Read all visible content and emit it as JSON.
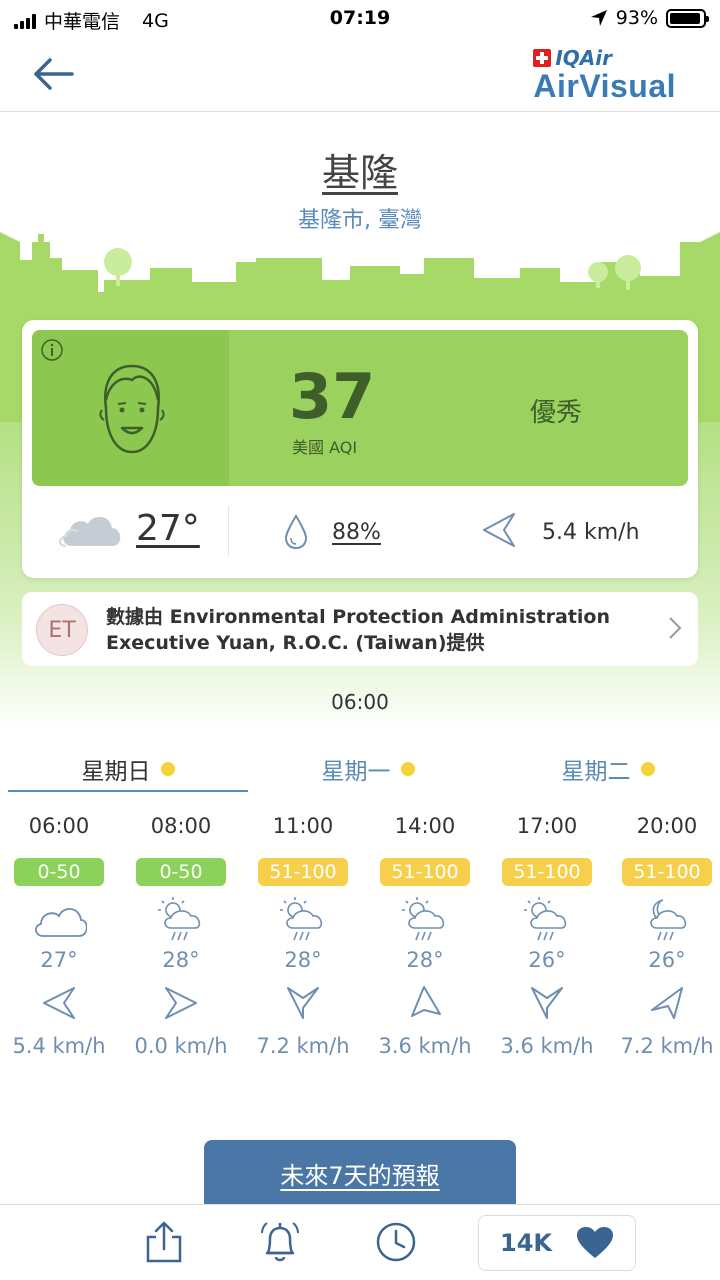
{
  "status_bar": {
    "carrier": "中華電信",
    "network": "4G",
    "time": "07:19",
    "battery": "93%"
  },
  "header": {
    "brand_top": "IQAir",
    "brand_bottom": "AirVisual"
  },
  "location": {
    "city": "基隆",
    "region": "基隆市, 臺灣"
  },
  "aqi": {
    "value": "37",
    "unit": "美國 AQI",
    "level": "優秀",
    "color": "#9ad15f"
  },
  "current_weather": {
    "temperature": "27°",
    "humidity": "88%",
    "wind": "5.4 km/h"
  },
  "source": {
    "badge": "ET",
    "text": "數據由 Environmental Protection Administration Executive Yuan, R.O.C. (Taiwan)提供"
  },
  "updated_time": "06:00",
  "tabs": [
    {
      "label": "星期日"
    },
    {
      "label": "星期一"
    },
    {
      "label": "星期二"
    }
  ],
  "hourly": [
    {
      "time": "06:00",
      "aqi": "0-50",
      "temp": "27°",
      "wind": "5.4 km/h",
      "icon": "cloud-icon"
    },
    {
      "time": "08:00",
      "aqi": "0-50",
      "temp": "28°",
      "wind": "0.0 km/h",
      "icon": "sun-rain-icon"
    },
    {
      "time": "11:00",
      "aqi": "51-100",
      "temp": "28°",
      "wind": "7.2 km/h",
      "icon": "sun-rain-icon"
    },
    {
      "time": "14:00",
      "aqi": "51-100",
      "temp": "28°",
      "wind": "3.6 km/h",
      "icon": "sun-rain-icon"
    },
    {
      "time": "17:00",
      "aqi": "51-100",
      "temp": "26°",
      "wind": "3.6 km/h",
      "icon": "sun-rain-icon"
    },
    {
      "time": "20:00",
      "aqi": "51-100",
      "temp": "26°",
      "wind": "7.2 km/h",
      "icon": "moon-rain-icon"
    }
  ],
  "forecast_button": "未來7天的預報",
  "bottom_bar": {
    "like_count": "14K"
  },
  "colors": {
    "accent": "#4a77a6",
    "aqi_good": "#8cd15a",
    "aqi_moderate": "#f6d04a"
  }
}
